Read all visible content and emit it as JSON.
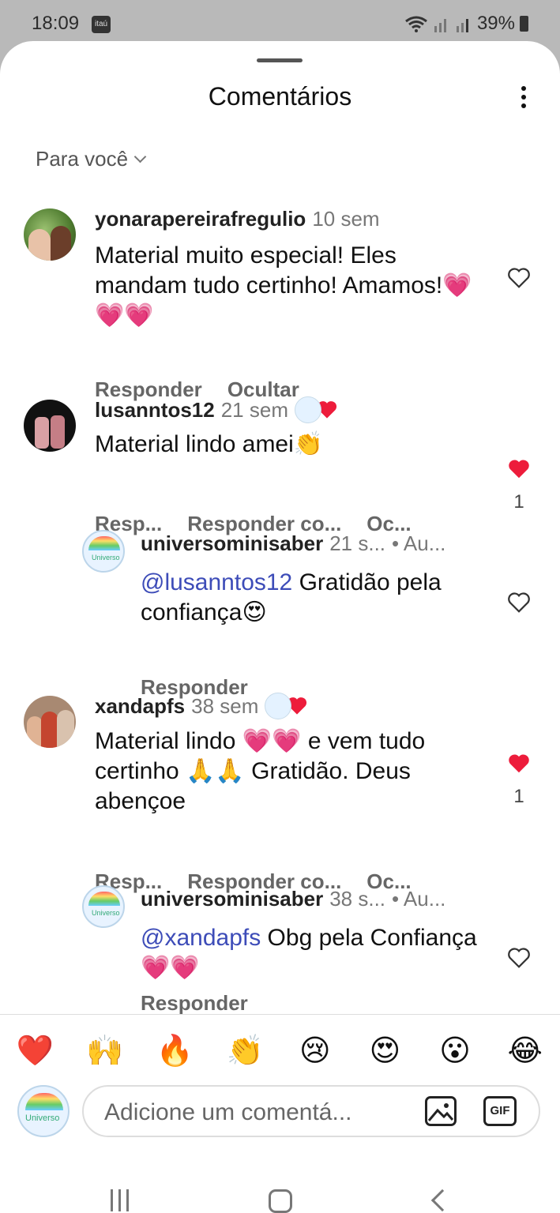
{
  "status": {
    "time": "18:09",
    "itau": "itaú",
    "battery": "39%"
  },
  "sheet": {
    "title": "Comentários"
  },
  "filter": {
    "label": "Para você"
  },
  "comments": [
    {
      "username": "yonarapereirafregulio",
      "time": "10 sem",
      "text": "Material muito especial! Eles mandam tudo certinho! Amamos!",
      "hearts": "💗💗💗",
      "actions": [
        "Responder",
        "Ocultar"
      ]
    },
    {
      "username": "lusanntos12",
      "time": "21 sem",
      "text": "Material lindo amei",
      "emoji": "👏",
      "actions": [
        "Resp...",
        "Responder co...",
        "Oc..."
      ],
      "likes": "1"
    },
    {
      "username": "universominisaber",
      "time": "21 s...",
      "extra": "• Au...",
      "mention": "@lusanntos12",
      "text": " Gratidão pela confiança",
      "emoji": "😍",
      "actions": [
        "Responder"
      ]
    },
    {
      "username": "xandapfs",
      "time": "38 sem",
      "text_a": "Material lindo ",
      "hearts": "💗💗",
      "text_b": " e vem tudo certinho ",
      "pray": "🙏🙏",
      "text_c": " Gratidão. Deus abençoe",
      "actions": [
        "Resp...",
        "Responder co...",
        "Oc..."
      ],
      "likes": "1"
    },
    {
      "username": "universominisaber",
      "time": "38 s...",
      "extra": "• Au...",
      "mention": "@xandapfs",
      "text": " Obg pela Confiança ",
      "hearts": "💗💗",
      "actions": [
        "Responder"
      ]
    }
  ],
  "reactions": [
    "❤️",
    "🙌",
    "🔥",
    "👏",
    "😢",
    "😍",
    "😮",
    "😂"
  ],
  "composer": {
    "placeholder": "Adicione um comentá...",
    "gif": "GIF",
    "avatar_text": "Universo"
  },
  "colors": {
    "like_red": "#ed1c3b",
    "mention_blue": "#3d4cb8"
  }
}
